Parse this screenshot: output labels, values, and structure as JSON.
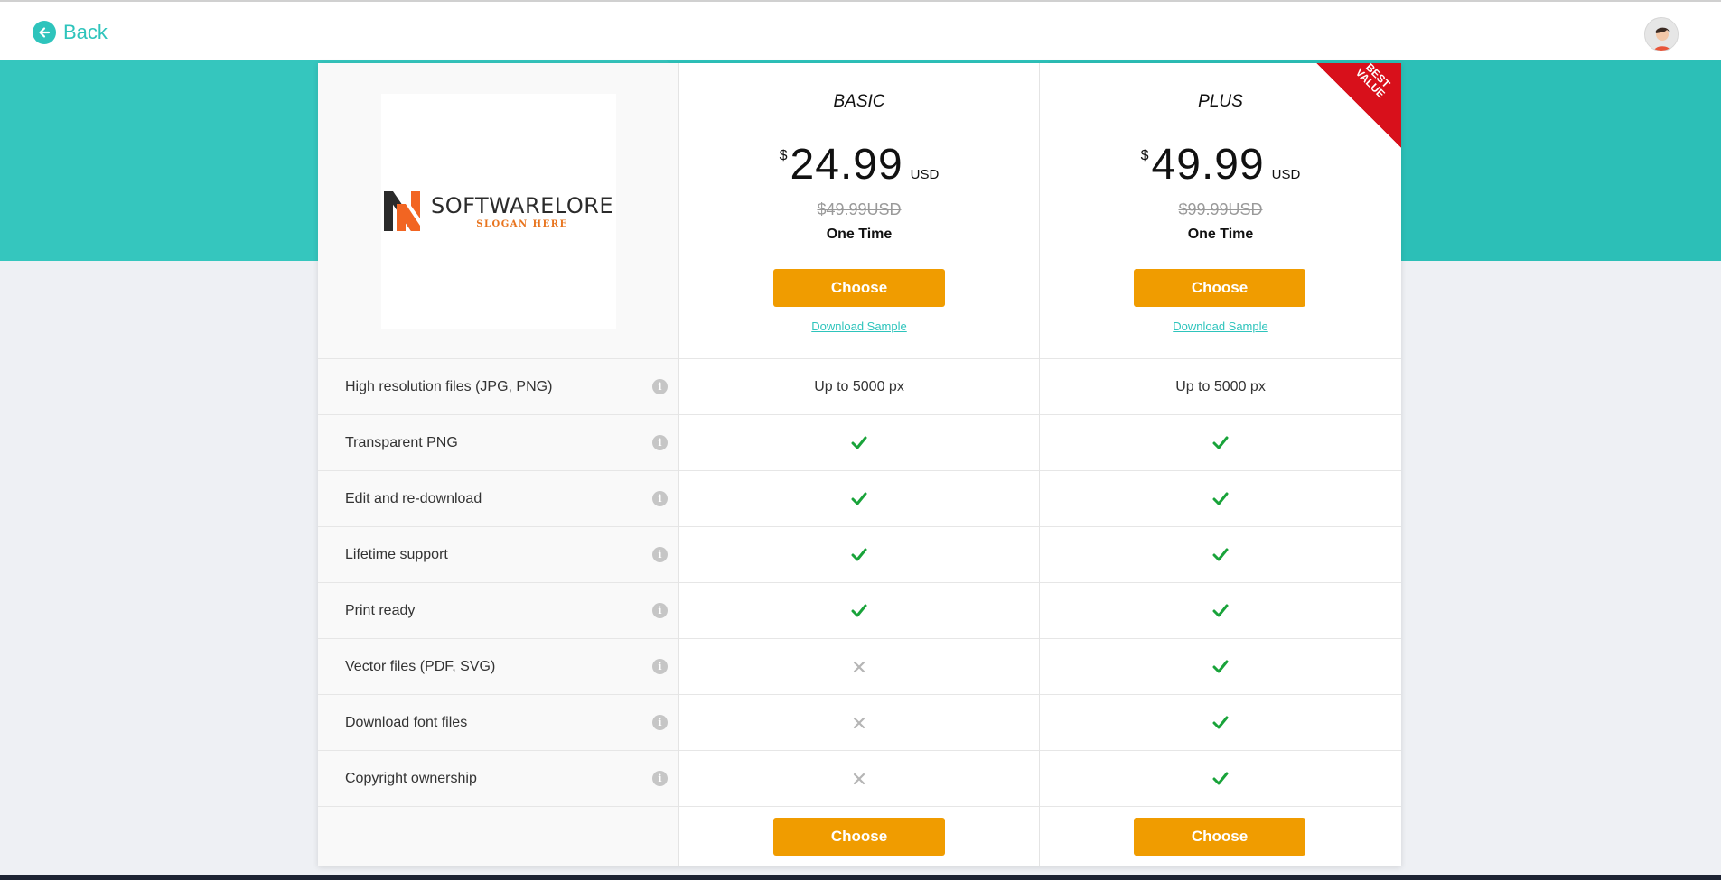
{
  "header": {
    "back_label": "Back"
  },
  "logo": {
    "name": "SOFTWARELORE",
    "slogan": "SLOGAN HERE"
  },
  "plans": [
    {
      "name": "BASIC",
      "currency_symbol": "$",
      "price": "24.99",
      "currency": "USD",
      "old_price": "$49.99USD",
      "term": "One Time",
      "choose_label": "Choose",
      "download_label": "Download Sample",
      "ribbon": ""
    },
    {
      "name": "PLUS",
      "currency_symbol": "$",
      "price": "49.99",
      "currency": "USD",
      "old_price": "$99.99USD",
      "term": "One Time",
      "choose_label": "Choose",
      "download_label": "Download Sample",
      "ribbon": "BEST VALUE"
    }
  ],
  "features": [
    {
      "label": "High resolution files (JPG, PNG)",
      "basic": "Up to 5000 px",
      "plus": "Up to 5000 px"
    },
    {
      "label": "Transparent PNG",
      "basic": "check",
      "plus": "check"
    },
    {
      "label": "Edit and re-download",
      "basic": "check",
      "plus": "check"
    },
    {
      "label": "Lifetime support",
      "basic": "check",
      "plus": "check"
    },
    {
      "label": "Print ready",
      "basic": "check",
      "plus": "check"
    },
    {
      "label": "Vector files (PDF, SVG)",
      "basic": "cross",
      "plus": "check"
    },
    {
      "label": "Download font files",
      "basic": "cross",
      "plus": "check"
    },
    {
      "label": "Copyright ownership",
      "basic": "cross",
      "plus": "check"
    }
  ],
  "colors": {
    "accent": "#2ec4bc",
    "button": "#f09c00",
    "check": "#19a33a",
    "cross": "#b5b5b5",
    "ribbon": "#d8101b"
  },
  "icons": {
    "back": "arrow-left-circle-icon",
    "info": "info-icon",
    "check": "check-icon",
    "cross": "cross-icon"
  }
}
